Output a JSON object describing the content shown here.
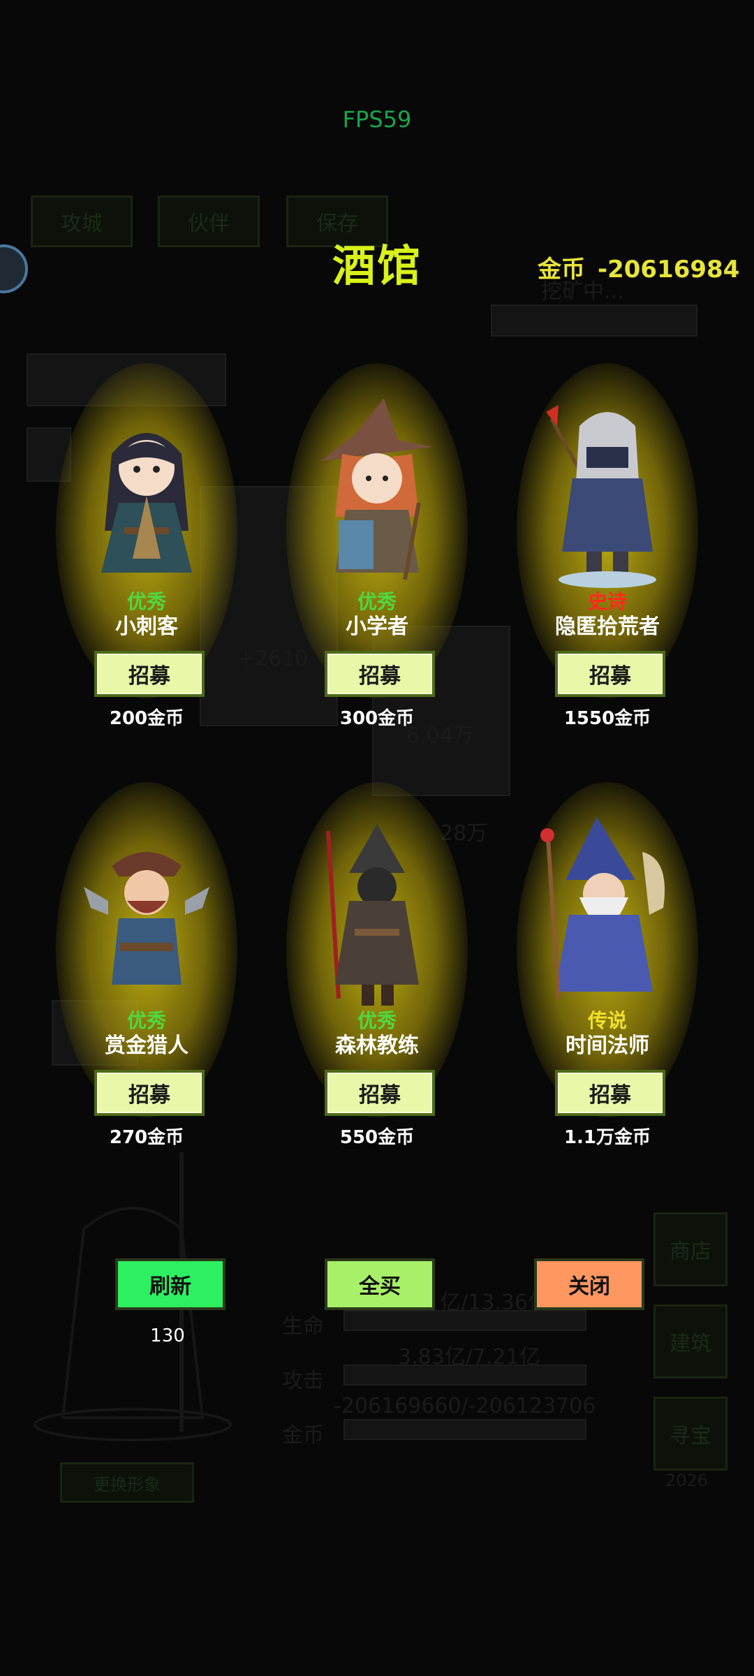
{
  "fps": "FPS59",
  "title": "酒馆",
  "gold": {
    "label": "金币",
    "value": "-20616984"
  },
  "heroes": [
    {
      "rarity": "优秀",
      "rarity_color": "#4fd840",
      "name": "小刺客",
      "recruit_label": "招募",
      "price": "200金币"
    },
    {
      "rarity": "优秀",
      "rarity_color": "#4fd840",
      "name": "小学者",
      "recruit_label": "招募",
      "price": "300金币"
    },
    {
      "rarity": "史诗",
      "rarity_color": "#ff2a1a",
      "name": "隐匿拾荒者",
      "recruit_label": "招募",
      "price": "1550金币"
    },
    {
      "rarity": "优秀",
      "rarity_color": "#4fd840",
      "name": "赏金猎人",
      "recruit_label": "招募",
      "price": "270金币"
    },
    {
      "rarity": "优秀",
      "rarity_color": "#4fd840",
      "name": "森林教练",
      "recruit_label": "招募",
      "price": "550金币"
    },
    {
      "rarity": "传说",
      "rarity_color": "#f0e030",
      "name": "时间法师",
      "recruit_label": "招募",
      "price": "1.1万金币"
    }
  ],
  "actions": {
    "refresh_label": "刷新",
    "refresh_count": "130",
    "buy_all_label": "全买",
    "close_label": "关闭"
  },
  "colors": {
    "refresh": "#2df060",
    "buy_all": "#a8f068",
    "close": "#ff9860",
    "title": "#d9f21a",
    "gold": "#e8e43a"
  },
  "background": {
    "tabs": [
      "攻城",
      "伙伴",
      "保存"
    ],
    "status": "挖矿中...",
    "side_buttons": [
      "商店",
      "建筑",
      "寻宝"
    ],
    "side_number": "2026",
    "stat_labels": [
      "生命",
      "攻击",
      "金币"
    ],
    "stat_values": [
      "亿/13.36亿",
      "3.83亿/7.21亿",
      "-206169660/-206123706"
    ],
    "misc_values": [
      "+2610",
      "6.04万",
      "28万"
    ],
    "change_look": "更换形象"
  }
}
